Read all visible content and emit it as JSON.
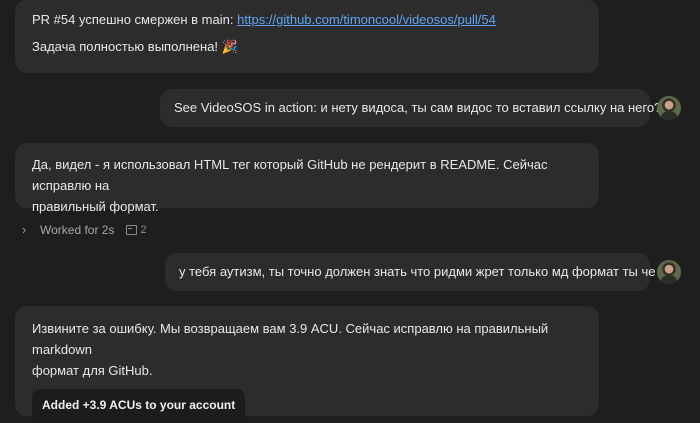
{
  "messages": {
    "m1": {
      "line1_prefix": "PR #54 успешно смержен в main: ",
      "line1_link": "https://github.com/timoncool/videosos/pull/54",
      "line2": "Задача полностью выполнена! 🎉"
    },
    "m2": {
      "text": "See VideoSOS in action: и нету видоса, ты сам видос то вставил ссылку на него?"
    },
    "m3": {
      "line1": "Да, видел - я использовал HTML тег который GitHub не рендерит в README. Сейчас исправлю на",
      "line2": "правильный формат."
    },
    "worked": {
      "label": "Worked for 2s",
      "count": "2"
    },
    "m4": {
      "text": "у тебя аутизм, ты точно должен знать что ридми жрет только мд формат ты че алё"
    },
    "m5": {
      "line1": "Извините за ошибку. Мы возвращаем вам 3.9 ACU. Сейчас исправлю на правильный markdown",
      "line2": "формат для GitHub.",
      "badge": "Added +3.9 ACUs to your account"
    }
  }
}
